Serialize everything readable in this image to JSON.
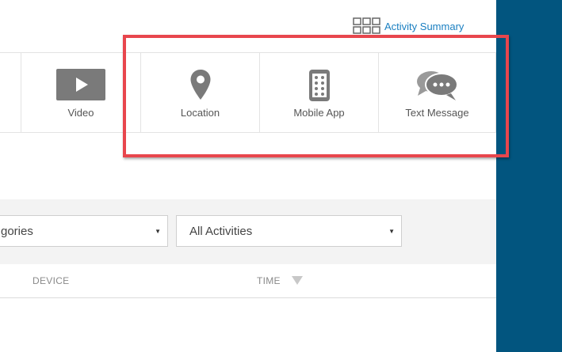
{
  "header": {
    "activity_summary_label": "Activity Summary",
    "activity_summary_icon": "grid-icon"
  },
  "activity_types": [
    {
      "label": "Video",
      "icon": "video-play-icon"
    },
    {
      "label": "Location",
      "icon": "map-pin-icon"
    },
    {
      "label": "Mobile App",
      "icon": "mobile-phone-icon"
    },
    {
      "label": "Text Message",
      "icon": "chat-bubbles-icon"
    }
  ],
  "filters": {
    "categories_value": "gories",
    "activities_value": "All Activities"
  },
  "table": {
    "columns": [
      "DEVICE",
      "TIME"
    ],
    "sort_icon": "sort-down-icon"
  },
  "colors": {
    "accent_link": "#1a7fc1",
    "highlight": "#e8464d",
    "side_panel": "#02557f",
    "icon_gray": "#7a7a7a"
  }
}
